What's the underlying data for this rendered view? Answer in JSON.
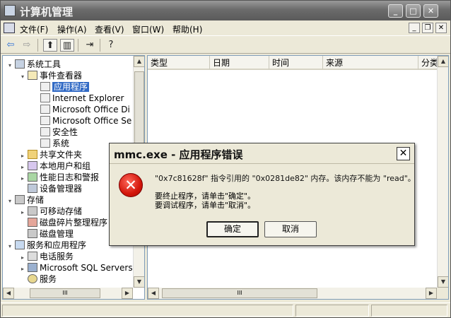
{
  "window": {
    "title": "计算机管理"
  },
  "menu": {
    "items": [
      {
        "label": "文件(F)"
      },
      {
        "label": "操作(A)"
      },
      {
        "label": "查看(V)"
      },
      {
        "label": "窗口(W)"
      },
      {
        "label": "帮助(H)"
      }
    ]
  },
  "tree": {
    "items": [
      {
        "label": "系统工具",
        "level": 0,
        "expander": "▾",
        "icon": "computer"
      },
      {
        "label": "事件查看器",
        "level": 1,
        "expander": "▾",
        "icon": "event"
      },
      {
        "label": "应用程序",
        "level": 2,
        "expander": "",
        "icon": "log",
        "selected": true
      },
      {
        "label": "Internet Explorer",
        "level": 2,
        "expander": "",
        "icon": "log"
      },
      {
        "label": "Microsoft Office Di",
        "level": 2,
        "expander": "",
        "icon": "log"
      },
      {
        "label": "Microsoft Office Se",
        "level": 2,
        "expander": "",
        "icon": "log"
      },
      {
        "label": "安全性",
        "level": 2,
        "expander": "",
        "icon": "log"
      },
      {
        "label": "系统",
        "level": 2,
        "expander": "",
        "icon": "log"
      },
      {
        "label": "共享文件夹",
        "level": 1,
        "expander": "▸",
        "icon": "folder"
      },
      {
        "label": "本地用户和组",
        "level": 1,
        "expander": "▸",
        "icon": "users"
      },
      {
        "label": "性能日志和警报",
        "level": 1,
        "expander": "▸",
        "icon": "perf"
      },
      {
        "label": "设备管理器",
        "level": 1,
        "expander": "",
        "icon": "device"
      },
      {
        "label": "存储",
        "level": 0,
        "expander": "▾",
        "icon": "disk"
      },
      {
        "label": "可移动存储",
        "level": 1,
        "expander": "▸",
        "icon": "disk"
      },
      {
        "label": "磁盘碎片整理程序",
        "level": 1,
        "expander": "",
        "icon": "defrag"
      },
      {
        "label": "磁盘管理",
        "level": 1,
        "expander": "",
        "icon": "disk"
      },
      {
        "label": "服务和应用程序",
        "level": 0,
        "expander": "▾",
        "icon": "services"
      },
      {
        "label": "电话服务",
        "level": 1,
        "expander": "▸",
        "icon": "phone"
      },
      {
        "label": "Microsoft SQL Servers",
        "level": 1,
        "expander": "▸",
        "icon": "sql"
      },
      {
        "label": "服务",
        "level": 1,
        "expander": "",
        "icon": "gear"
      }
    ]
  },
  "list": {
    "columns": [
      {
        "label": "类型"
      },
      {
        "label": "日期"
      },
      {
        "label": "时间"
      },
      {
        "label": "来源"
      },
      {
        "label": "分类"
      }
    ]
  },
  "scroll": {
    "h_thumb_grip": "III"
  },
  "dialog": {
    "title": "mmc.exe - 应用程序错误",
    "message": "\"0x7c81628f\" 指令引用的 \"0x0281de82\" 内存。该内存不能为 \"read\"。",
    "hint1": "要终止程序，请单击\"确定\"。",
    "hint2": "要调试程序，请单击\"取消\"。",
    "ok_label": "确定",
    "cancel_label": "取消"
  }
}
